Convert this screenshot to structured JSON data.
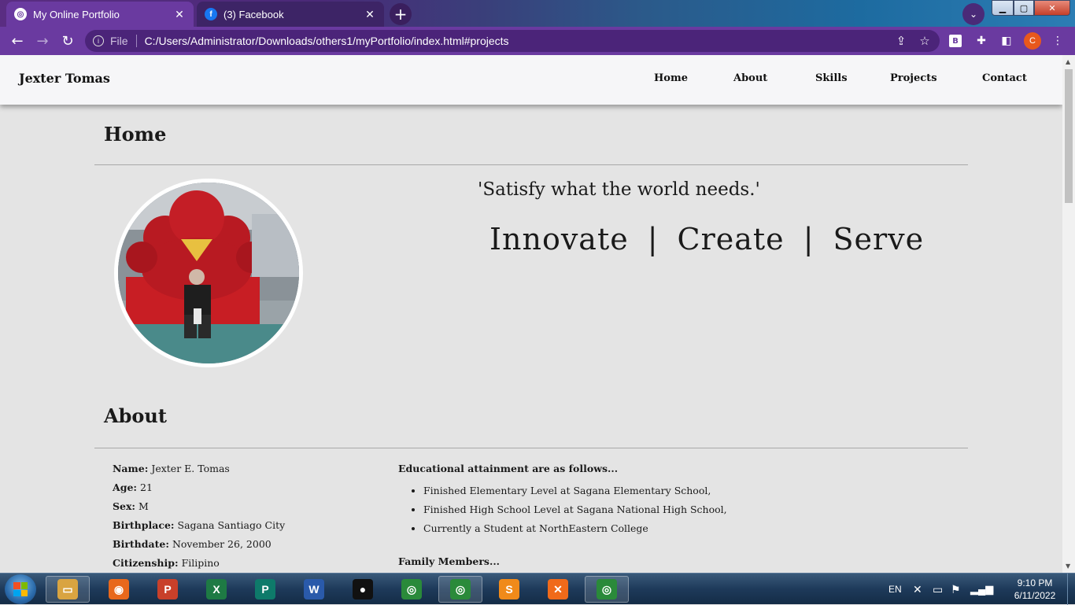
{
  "browser": {
    "tabs": [
      {
        "title": "My Online Portfolio",
        "icon": "globe-icon",
        "active": true
      },
      {
        "title": "(3) Facebook",
        "icon": "facebook-icon",
        "active": false
      }
    ],
    "address": {
      "scheme_label": "File",
      "url": "C:/Users/Administrator/Downloads/others1/myPortfolio/index.html#projects"
    },
    "profile_initial": "C",
    "extension_label": "B"
  },
  "site": {
    "brand": "Jexter Tomas",
    "nav": [
      "Home",
      "About",
      "Skills",
      "Projects",
      "Contact"
    ],
    "home": {
      "title": "Home",
      "quote": "'Satisfy what the world needs.'",
      "motto": [
        "Innovate",
        "Create",
        "Serve"
      ],
      "motto_divider": "|"
    },
    "about": {
      "title": "About",
      "details": [
        {
          "label": "Name:",
          "value": "Jexter E. Tomas"
        },
        {
          "label": "Age:",
          "value": "21"
        },
        {
          "label": "Sex:",
          "value": "M"
        },
        {
          "label": "Birthplace:",
          "value": "Sagana Santiago City"
        },
        {
          "label": "Birthdate:",
          "value": "November 26, 2000"
        },
        {
          "label": "Citizenship:",
          "value": "Filipino"
        }
      ],
      "education_heading": "Educational attainment are as follows...",
      "education": [
        "Finished Elementary Level at Sagana Elementary School,",
        "Finished High School Level at Sagana National High School,",
        "Currently a Student at NorthEastern College"
      ],
      "family_heading": "Family Members..."
    }
  },
  "taskbar": {
    "apps": [
      {
        "name": "file-explorer",
        "glyph": "▭",
        "color": "#d9a441"
      },
      {
        "name": "firefox",
        "glyph": "◉",
        "color": "#e8681c"
      },
      {
        "name": "powerpoint",
        "glyph": "P",
        "color": "#c8402a"
      },
      {
        "name": "excel",
        "glyph": "X",
        "color": "#1e7a44"
      },
      {
        "name": "publisher",
        "glyph": "P",
        "color": "#0e7a6a"
      },
      {
        "name": "word",
        "glyph": "W",
        "color": "#2a5aaa"
      },
      {
        "name": "screen-recorder",
        "glyph": "●",
        "color": "#111111"
      },
      {
        "name": "chrome",
        "glyph": "◎",
        "color": "#2a8a3a"
      },
      {
        "name": "chrome-profile",
        "glyph": "◎",
        "color": "#2a8a3a"
      },
      {
        "name": "sublime-text",
        "glyph": "S",
        "color": "#f08a1a"
      },
      {
        "name": "xampp",
        "glyph": "✕",
        "color": "#f06a1a"
      },
      {
        "name": "chrome-alt",
        "glyph": "◎",
        "color": "#2a8a3a"
      }
    ],
    "language": "EN",
    "time": "9:10 PM",
    "date": "6/11/2022"
  }
}
